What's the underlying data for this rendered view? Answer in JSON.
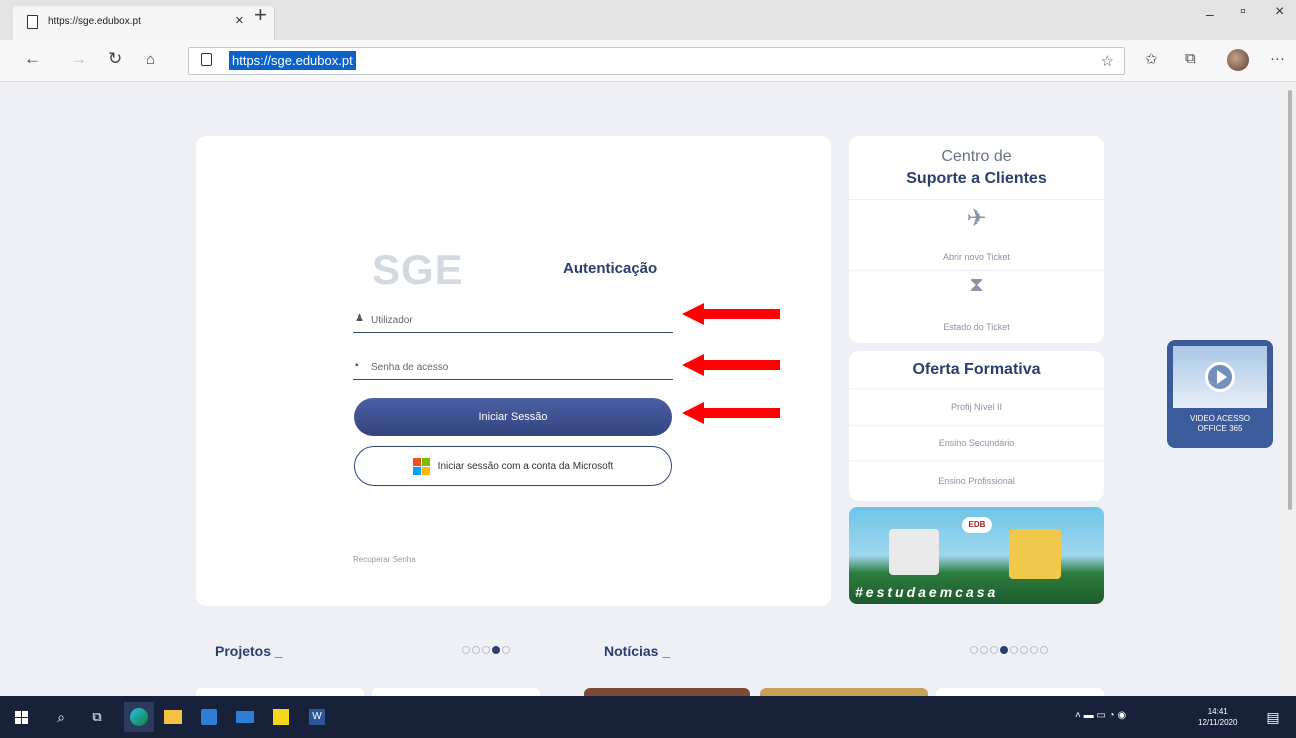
{
  "browser": {
    "tab_title": "https://sge.edubox.pt",
    "tab_close": "×",
    "new_tab": "+",
    "minimize": "–",
    "maximize": "▫",
    "close": "×",
    "url": "https://sge.edubox.pt",
    "more": "···"
  },
  "login": {
    "logo": "SGE",
    "title": "Autenticação",
    "username_placeholder": "Utilizador",
    "password_placeholder": "Senha de acesso",
    "login_button": "Iniciar Sessão",
    "microsoft_button": "Iniciar sessão com a conta da Microsoft",
    "recover": "Recuperar Senha"
  },
  "support": {
    "title_line1": "Centro de",
    "title_line2": "Suporte a Clientes",
    "new_ticket": "Abrir novo Ticket",
    "ticket_status": "Estado do Ticket"
  },
  "oferta": {
    "title": "Oferta Formativa",
    "items": [
      "Profij Nível II",
      "Ensino Secundário",
      "Ensino Profissional"
    ]
  },
  "banner": {
    "hashtag": "#estudaemcasa",
    "cloud_text": "EDB"
  },
  "video": {
    "line1": "VIDEO ACESSO",
    "line2": "OFFICE 365"
  },
  "sections": {
    "projetos": "Projetos _",
    "noticias": "Notícias _",
    "projetos_dots": 5,
    "projetos_active": 4,
    "noticias_dots": 8,
    "noticias_active": 4
  },
  "taskbar": {
    "time": "14:41",
    "date": "12/11/2020"
  },
  "colors": {
    "brand_dark": "#2b3e6d",
    "arrow_red": "#ff0000",
    "taskbar": "#17223a"
  }
}
